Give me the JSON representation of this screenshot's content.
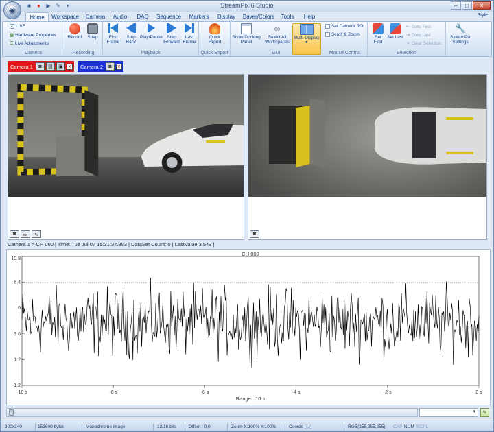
{
  "window": {
    "title": "StreamPix 6 Studio",
    "style_label": "Style"
  },
  "tabs": [
    "Home",
    "Workspace",
    "Camera",
    "Audio",
    "DAQ",
    "Sequence",
    "Markers",
    "Display",
    "Bayer/Colors",
    "Tools",
    "Help"
  ],
  "ribbon": {
    "camera_group": {
      "label": "Camera",
      "live": "LIVE",
      "hardware": "Hardware Properties",
      "adjust": "Live Adjustments"
    },
    "recording_group": {
      "label": "Recording",
      "record": "Record",
      "snap": "Snap"
    },
    "playback_group": {
      "label": "Playback",
      "first": "First Frame",
      "step_back": "Step Back",
      "play": "Play/Pause",
      "step_fwd": "Step Forward",
      "last": "Last Frame"
    },
    "quick_export_group": {
      "label": "Quick Export",
      "quick": "Quick Export"
    },
    "gui_group": {
      "label": "GUI",
      "docking": "Show Docking Panel",
      "select_all": "Select All Workspaces",
      "multi": "Multi-Display"
    },
    "mouse_group": {
      "label": "Mouse Control",
      "roi": "Set Camera ROI",
      "scroll": "Scroll & Zoom"
    },
    "selection_group": {
      "label": "Selection",
      "set_first": "Set First",
      "set_last": "Set Last",
      "goto_first": "Goto First",
      "goto_last": "Goto Last",
      "clear": "Clear Selection"
    },
    "settings_group": {
      "settings": "StreamPix Settings"
    }
  },
  "cameras": {
    "cam1": "Camera 1",
    "cam2": "Camera 2"
  },
  "status_line": "Camera 1 > CH 000 | Time: Tue Jul 07 15:31:34.883 | DataSet Count: 0 | LastValue 3.543 |",
  "chart_data": {
    "type": "line",
    "title": "CH 000",
    "range_label": "Range : 10 s",
    "ylim": [
      -1.2,
      10.8
    ],
    "yticks": [
      "10.8",
      "8.4",
      "6",
      "3.6",
      "1.2",
      "-1.2"
    ],
    "xticks": [
      "-10 s",
      "-8 s",
      "-6 s",
      "-4 s",
      "-2 s",
      "0 s"
    ],
    "reference_line": 8.4,
    "series": [
      {
        "values": []
      }
    ]
  },
  "statusbar": {
    "resolution": "320x240",
    "bytes": "153600 bytes",
    "image_type": "Monochrome image",
    "bits": "12/16 bits",
    "offset": "Offset : 0,0",
    "zoom": "Zoom X:100% Y:100%",
    "coords": "Coords (-,-)",
    "rgb": "RGB(255,255,255)",
    "cap": "CAP",
    "num": "NUM",
    "scrl": "SCRL"
  }
}
